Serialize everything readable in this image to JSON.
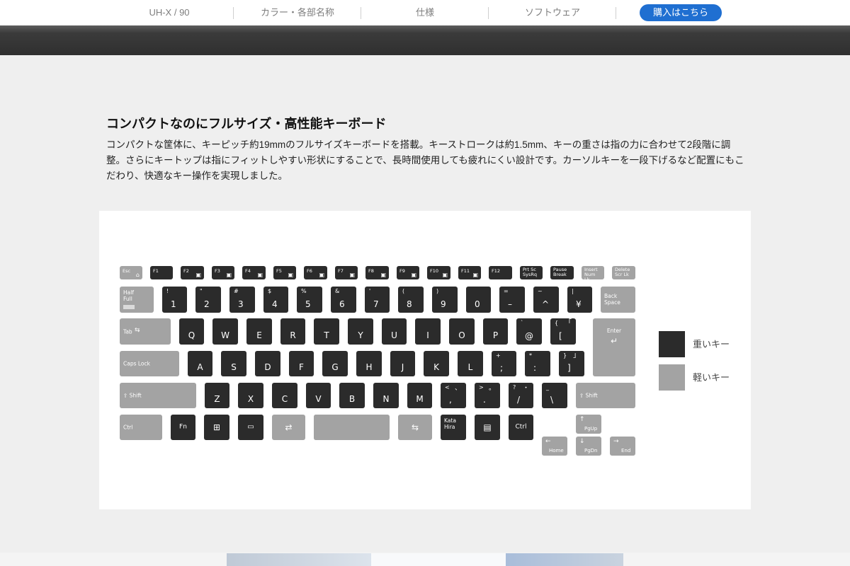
{
  "nav": {
    "items": [
      "UH-X / 90",
      "カラー・各部名称",
      "仕様",
      "ソフトウェア"
    ],
    "buy_label": "購入はこちら",
    "buy_color": "#1f6fd1"
  },
  "section": {
    "title": "コンパクトなのにフルサイズ・高性能キーボード",
    "body": "コンパクトな筐体に、キーピッチ約19mmのフルサイズキーボードを搭載。キーストロークは約1.5mm、キーの重さは指の力に合わせて2段階に調整。さらにキートップは指にフィットしやすい形状にすることで、長時間使用しても疲れにくい設計です。カーソルキーを一段下げるなど配置にもこだわり、快適なキー操作を実現しました。"
  },
  "legend": {
    "heavy": "重いキー",
    "light": "軽いキー",
    "heavy_color": "#2b2b2b",
    "light_color": "#a3a3a3"
  },
  "keyboard": {
    "function_row": [
      "Esc",
      "F1",
      "F2",
      "F3",
      "F4",
      "F5",
      "F6",
      "F7",
      "F8",
      "F9",
      "F10",
      "F11",
      "F12",
      "Prt Sc SysRq",
      "Pause Break",
      "Insert Num Lk",
      "Delete Scr Lk"
    ],
    "number_row": [
      {
        "top": "Half Full",
        "main": ""
      },
      {
        "top": "!",
        "main": "1"
      },
      {
        "top": "\"",
        "main": "2"
      },
      {
        "top": "#",
        "main": "3"
      },
      {
        "top": "$",
        "main": "4"
      },
      {
        "top": "%",
        "main": "5"
      },
      {
        "top": "&",
        "main": "6"
      },
      {
        "top": "'",
        "main": "7"
      },
      {
        "top": "(",
        "main": "8"
      },
      {
        "top": ")",
        "main": "9"
      },
      {
        "top": "",
        "main": "0"
      },
      {
        "top": "=",
        "main": "–"
      },
      {
        "top": "~",
        "main": "^"
      },
      {
        "top": "|",
        "main": "¥"
      },
      {
        "top": "Back Space",
        "main": ""
      }
    ],
    "tab_row": [
      "Tab",
      "Q",
      "W",
      "E",
      "R",
      "T",
      "Y",
      "U",
      "I",
      "O",
      "P",
      "`",
      "{",
      "Enter"
    ],
    "tab_row_sub": {
      "at": "@",
      "bracket": "[",
      "kbracket": "「"
    },
    "caps_row": [
      "Caps Lock",
      "A",
      "S",
      "D",
      "F",
      "G",
      "H",
      "J",
      "K",
      "L",
      "+",
      "*",
      "}"
    ],
    "caps_row_sub": {
      "semicolon": ";",
      "colon": ":",
      "bracket": "]",
      "kbracket": "」"
    },
    "shift_row": [
      "Shift",
      "Z",
      "X",
      "C",
      "V",
      "B",
      "N",
      "M",
      "<",
      ">",
      "?",
      "_",
      "Shift"
    ],
    "shift_row_sub": {
      "comma": ",",
      "period": ".",
      "slash": "/",
      "backslash": "\\",
      "ten": "、",
      "maru": "。",
      "naka": "・"
    },
    "bottom_row": [
      "Ctrl",
      "Fn",
      "Kata Hira",
      "Ctrl"
    ],
    "arrows": [
      "PgUp",
      "Home",
      "PgDn",
      "End"
    ]
  }
}
